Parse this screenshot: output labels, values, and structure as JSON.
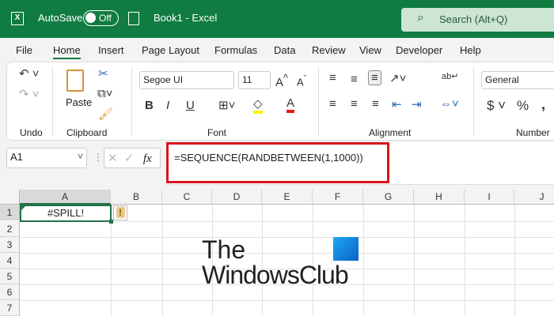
{
  "titlebar": {
    "app_icon": "excel-icon",
    "autosave": "AutoSave",
    "toggle": "Off",
    "title": "Book1  -  Excel",
    "search": "Search (Alt+Q)"
  },
  "tabs": [
    "File",
    "Home",
    "Insert",
    "Page Layout",
    "Formulas",
    "Data",
    "Review",
    "View",
    "Developer",
    "Help"
  ],
  "ribbon": {
    "groups": [
      "Undo",
      "Clipboard",
      "Font",
      "Alignment",
      "Number"
    ],
    "paste": "Paste",
    "font_name": "Segoe UI",
    "font_size": "11",
    "number_format": "General",
    "bold": "B",
    "italic": "I",
    "underline": "U"
  },
  "formula_bar": {
    "name_box": "A1",
    "fx": "fx",
    "formula": "=SEQUENCE(RANDBETWEEN(1,1000))"
  },
  "sheet": {
    "columns": [
      "A",
      "B",
      "C",
      "D",
      "E",
      "F",
      "G",
      "H",
      "I",
      "J"
    ],
    "rows": [
      "1",
      "2",
      "3",
      "4",
      "5",
      "6",
      "7"
    ],
    "a1_value": "#SPILL!"
  },
  "watermark": {
    "line1": "The",
    "line2": "WindowsClub"
  },
  "colors": {
    "brand": "#107c41",
    "highlight": "#d9141b"
  }
}
